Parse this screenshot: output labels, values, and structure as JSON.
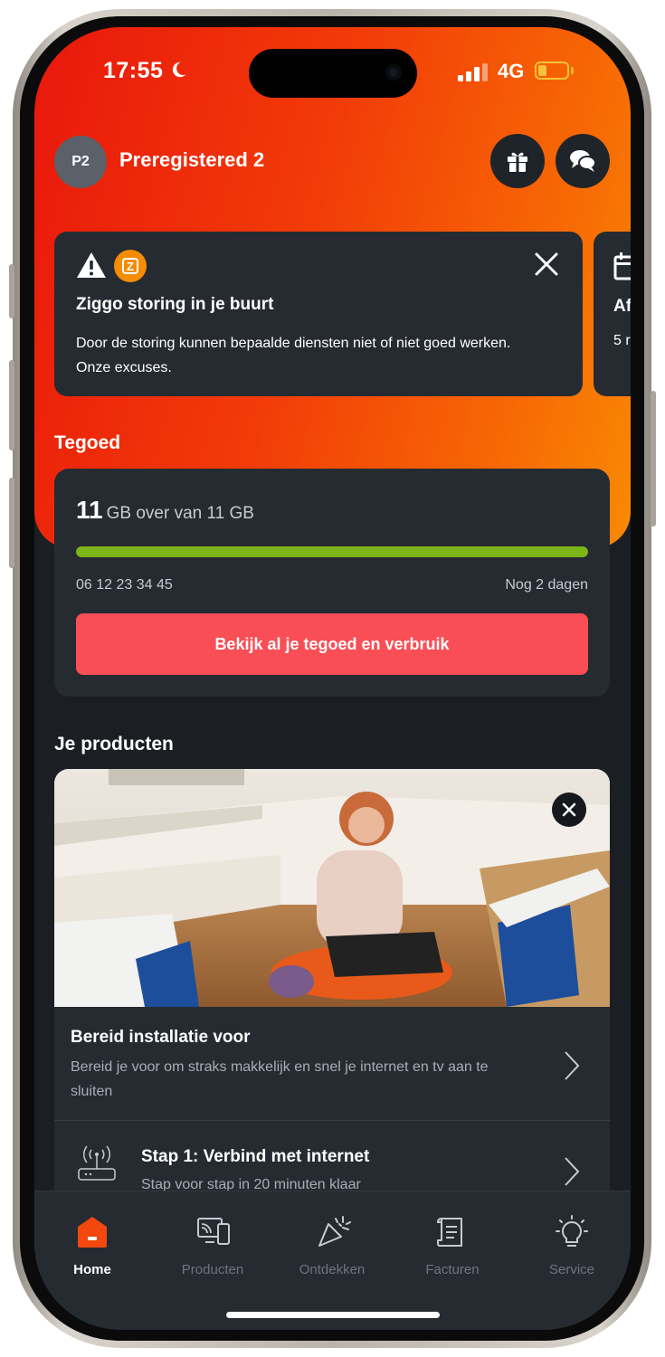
{
  "status_bar": {
    "time": "17:55",
    "network": "4G"
  },
  "header": {
    "avatar_initials": "P2",
    "user_name": "Preregistered 2"
  },
  "notice": {
    "title": "Ziggo storing in je buurt",
    "text": "Door de storing kunnen bepaalde diensten niet of niet goed werken. Onze excuses.",
    "brand_letter": "Z",
    "next_title_fragment": "Af",
    "next_text_fragment": "5 r"
  },
  "credit": {
    "section_title": "Tegoed",
    "amount": "11",
    "amount_text": "GB over van 11 GB",
    "progress_fraction": 1.0,
    "phone_number": "06 12 23 34 45",
    "days_left": "Nog 2 dagen",
    "cta_label": "Bekijk al je tegoed en verbruik"
  },
  "products": {
    "section_title": "Je producten",
    "items": [
      {
        "title": "Bereid installatie voor",
        "subtitle": "Bereid je voor om straks makkelijk en snel je internet en tv aan te sluiten"
      },
      {
        "title": "Stap 1: Verbind met internet",
        "subtitle": "Stap voor stap in 20 minuten klaar"
      }
    ]
  },
  "tabbar": {
    "tabs": [
      {
        "label": "Home",
        "icon": "home-icon",
        "active": true
      },
      {
        "label": "Producten",
        "icon": "devices-icon",
        "active": false
      },
      {
        "label": "Ontdekken",
        "icon": "party-popper-icon",
        "active": false
      },
      {
        "label": "Facturen",
        "icon": "invoice-icon",
        "active": false
      },
      {
        "label": "Service",
        "icon": "lightbulb-icon",
        "active": false
      }
    ]
  },
  "colors": {
    "hero_gradient_start": "#e9170c",
    "hero_gradient_end": "#f98a03",
    "cta": "#f94e55",
    "progress": "#7cb518",
    "card": "#262b32",
    "background": "#1b1f24",
    "ziggo_orange": "#f48c06"
  }
}
